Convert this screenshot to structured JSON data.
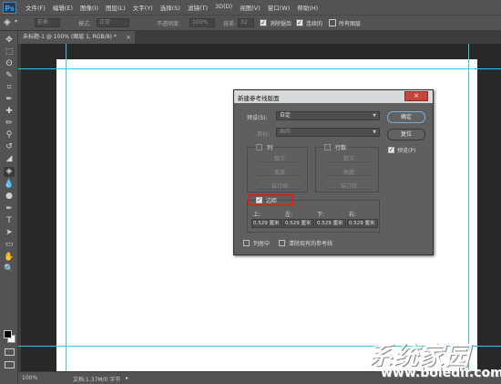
{
  "app": {
    "logo": "Ps"
  },
  "menu": [
    "文件(F)",
    "编辑(E)",
    "图像(I)",
    "图层(L)",
    "文字(Y)",
    "选择(S)",
    "滤镜(T)",
    "3D(D)",
    "视图(V)",
    "窗口(W)",
    "帮助(H)"
  ],
  "options_bar": {
    "preset_label": "前景",
    "mode_label": "模式:",
    "mode_value": "正常",
    "opacity_label": "不透明度:",
    "opacity_value": "100%",
    "tolerance_label": "容差:",
    "tolerance_value": "32",
    "antialias_label": "消除锯齿",
    "contiguous_label": "连续的",
    "all_layers_label": "所有图层"
  },
  "tab": {
    "title": "未标题-1 @ 100% (图层 1, RGB/8) *",
    "close": "×"
  },
  "toolbar_icons": [
    "move-icon",
    "marquee-icon",
    "lasso-icon",
    "quick-select-icon",
    "crop-icon",
    "eyedropper-icon",
    "healing-icon",
    "brush-icon",
    "stamp-icon",
    "history-brush-icon",
    "eraser-icon",
    "paint-bucket-icon",
    "blur-icon",
    "dodge-icon",
    "pen-icon",
    "type-icon",
    "path-select-icon",
    "rectangle-icon",
    "hand-icon",
    "zoom-icon"
  ],
  "toolbar_glyphs": [
    "✥",
    "⬚",
    "ʘ",
    "✎",
    "⌗",
    "✒",
    "✚",
    "✏",
    "⚲",
    "↺",
    "◢",
    "◈",
    "💧",
    "●",
    "✒",
    "T",
    "➤",
    "▭",
    "✋",
    "🔍"
  ],
  "dialog": {
    "title": "新建参考线版面",
    "close": "×",
    "preset_label": "预设(S):",
    "preset_value": "自定",
    "target_label": "目标:",
    "target_value": "画布",
    "ok": "确定",
    "reset": "复位",
    "preview_label": "预览(P)",
    "columns": {
      "label": "列",
      "number": "数字",
      "width": "宽度",
      "gutter": "装订线"
    },
    "rows": {
      "label": "行数",
      "number": "数字",
      "height": "高度",
      "gutter": "装订线"
    },
    "margin": {
      "label": "边距",
      "top_label": "上:",
      "left_label": "左:",
      "bottom_label": "下:",
      "right_label": "右:",
      "top_value": "0.529 厘米",
      "left_value": "0.529 厘米",
      "bottom_value": "0.529 厘米",
      "right_value": "0.529 厘米"
    },
    "center_columns_label": "列居中",
    "clear_guides_label": "清除现有的参考线"
  },
  "status": {
    "zoom": "100%",
    "doc_info": "文档:1.37M/0 字节"
  },
  "watermark": {
    "title": "系统家园",
    "url": "www.boledir.com"
  },
  "colors": {
    "guide": "#38c7e6",
    "highlight": "#e02020",
    "close_button": "#c7463b"
  }
}
